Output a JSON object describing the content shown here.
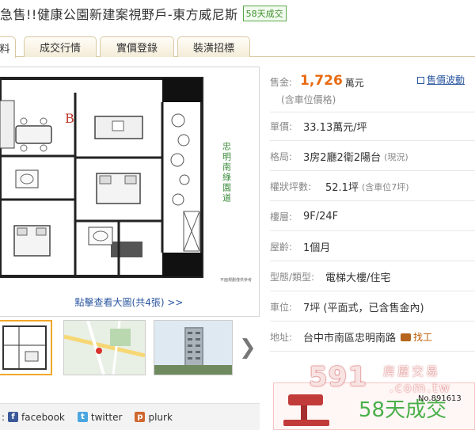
{
  "header": {
    "title": "急售!!健康公園新建案視野戶-東方威尼斯",
    "badge": "58天成交"
  },
  "tabs": [
    {
      "label": "料",
      "active": true
    },
    {
      "label": "成交行情",
      "active": false
    },
    {
      "label": "實價登錄",
      "active": false
    },
    {
      "label": "裝潢招標",
      "active": false
    }
  ],
  "gallery": {
    "plan_room_letter": "B",
    "plan_side_text": "忠明南綠園道",
    "plan_caption": "平面規劃僅供參考",
    "view_all_label": "點擊查看大圖(共4張) >>",
    "next_arrow": "❯"
  },
  "share": {
    "prefix": ":",
    "items": [
      {
        "label": "facebook",
        "icon": "facebook-icon",
        "color": "#3b5998"
      },
      {
        "label": "twitter",
        "icon": "twitter-icon",
        "color": "#4ba6e0"
      },
      {
        "label": "plurk",
        "icon": "plurk-icon",
        "color": "#cf682f"
      }
    ]
  },
  "info": {
    "price_label": "售金:",
    "price_value": "1,726",
    "price_unit": "萬元",
    "price_note": "(含車位價格)",
    "price_wave_link": "售價波動",
    "unit_price_label": "單價:",
    "unit_price_value": "33.13萬元/坪",
    "layout_label": "格局:",
    "layout_value": "3房2廳2衛2陽台",
    "layout_note": "(現況)",
    "area_label": "權狀坪數:",
    "area_value": "52.1坪",
    "area_note": "(含車位7坪)",
    "floor_label": "樓層:",
    "floor_value": "9F/24F",
    "age_label": "屋齡:",
    "age_value": "1個月",
    "type_label": "型態/類型:",
    "type_value": "電梯大樓/住宅",
    "parking_label": "車位:",
    "parking_value": "7坪 (平面式，已含售金內)",
    "address_label": "地址:",
    "address_value": "台中市南區忠明南路",
    "find_work_label": "找工"
  },
  "sold": {
    "logo_number": "591",
    "logo_text": "房屋交易",
    "logo_domain": ".com.tw",
    "sold_text": "58天成交",
    "sold_no": "No.891613"
  },
  "colors": {
    "price": "#e86a10",
    "link": "#2a56a0",
    "sold_green": "#4bb04b",
    "badge_green": "#5aa84a"
  }
}
